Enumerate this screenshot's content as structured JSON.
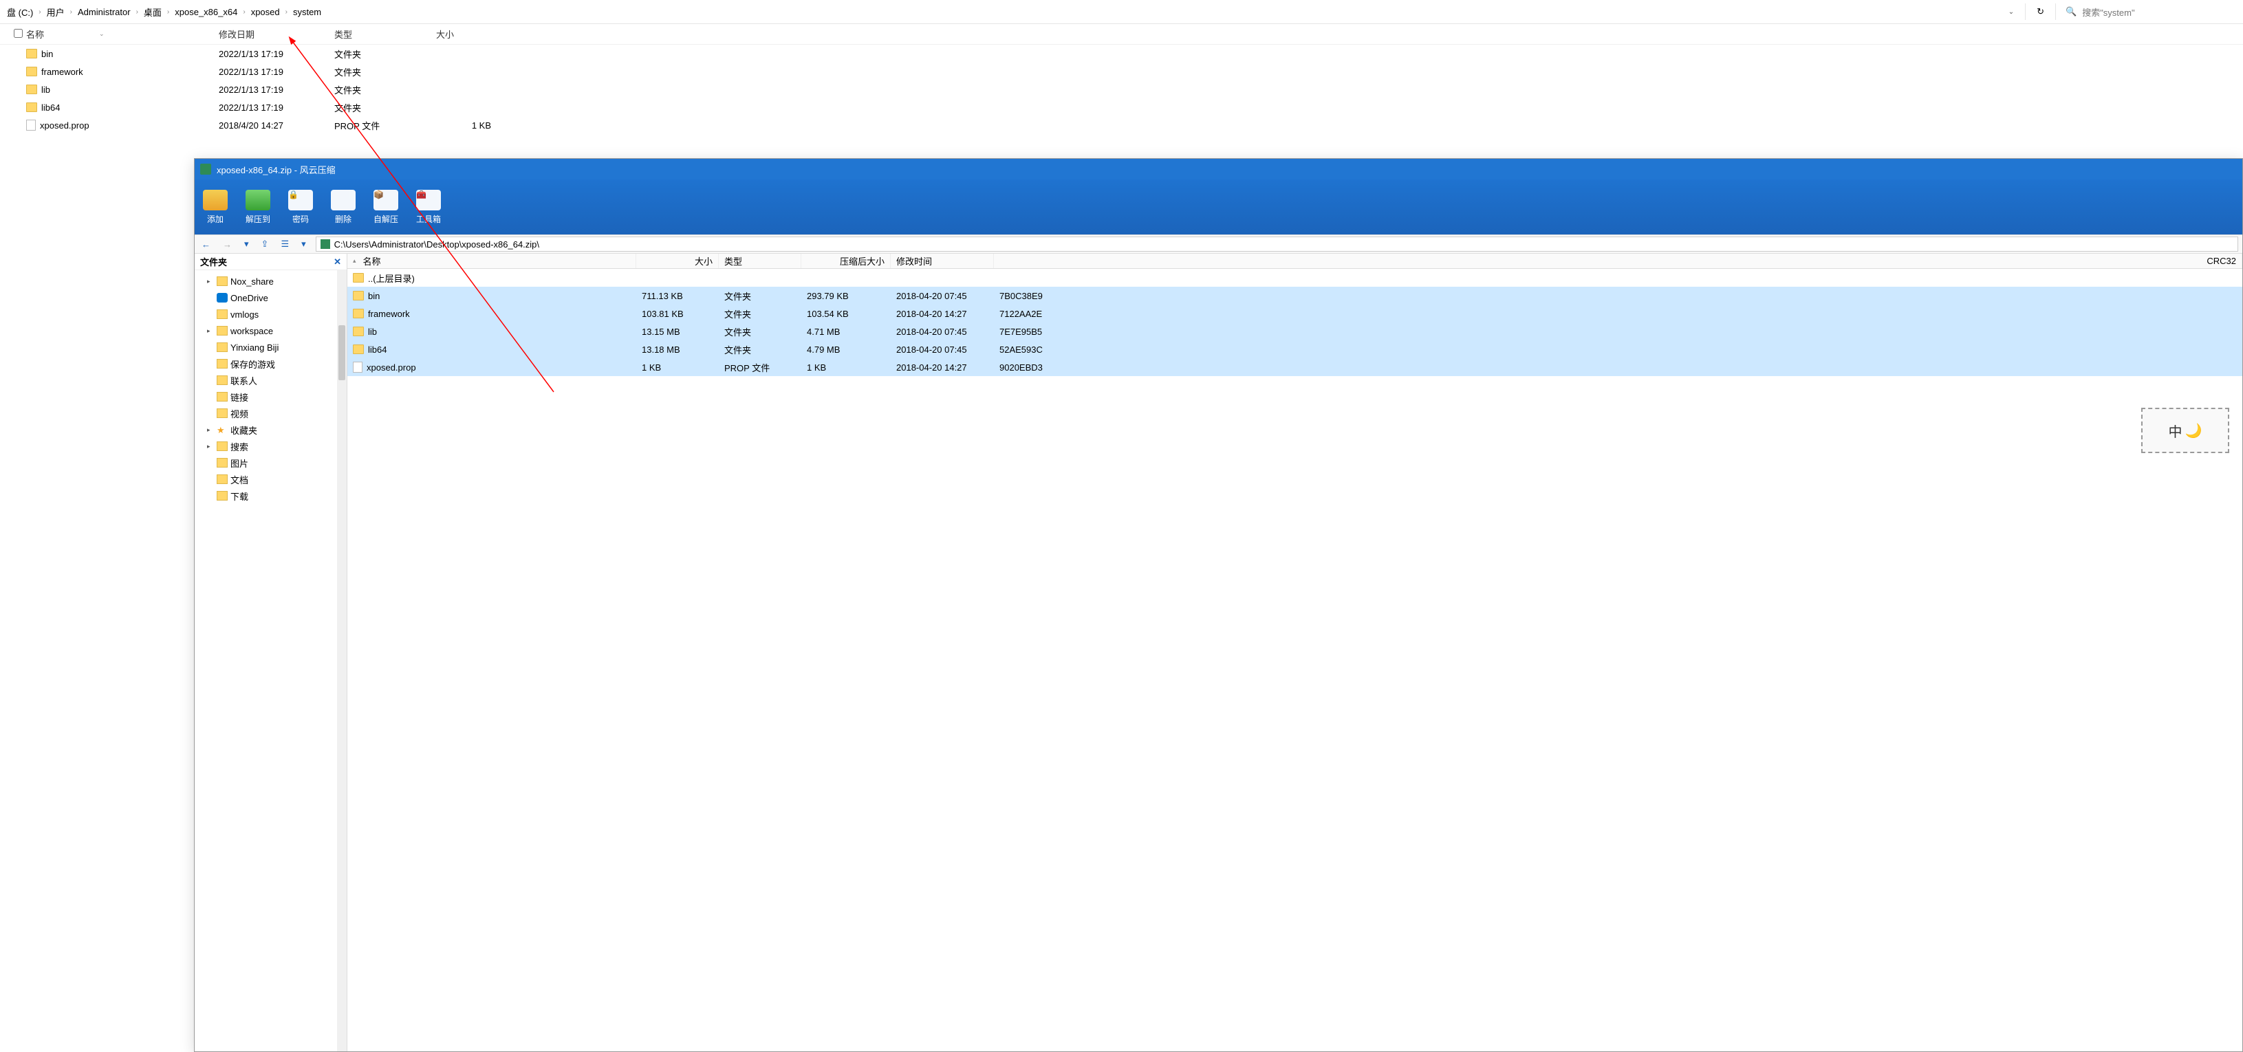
{
  "explorer": {
    "breadcrumb": [
      "盘 (C:)",
      "用户",
      "Administrator",
      "桌面",
      "xpose_x86_x64",
      "xposed",
      "system"
    ],
    "search_placeholder": "搜索\"system\"",
    "columns": {
      "name": "名称",
      "date": "修改日期",
      "type": "类型",
      "size": "大小"
    },
    "rows": [
      {
        "icon": "folder",
        "name": "bin",
        "date": "2022/1/13 17:19",
        "type": "文件夹",
        "size": ""
      },
      {
        "icon": "folder",
        "name": "framework",
        "date": "2022/1/13 17:19",
        "type": "文件夹",
        "size": ""
      },
      {
        "icon": "folder",
        "name": "lib",
        "date": "2022/1/13 17:19",
        "type": "文件夹",
        "size": ""
      },
      {
        "icon": "folder",
        "name": "lib64",
        "date": "2022/1/13 17:19",
        "type": "文件夹",
        "size": ""
      },
      {
        "icon": "file",
        "name": "xposed.prop",
        "date": "2018/4/20 14:27",
        "type": "PROP 文件",
        "size": "1 KB"
      }
    ]
  },
  "archive": {
    "title": "xposed-x86_64.zip - 风云压缩",
    "toolbar": {
      "add": "添加",
      "extract": "解压到",
      "password": "密码",
      "delete": "删除",
      "sfx": "自解压",
      "tools": "工具箱"
    },
    "path": "C:\\Users\\Administrator\\Desktop\\xposed-x86_64.zip\\",
    "side_title": "文件夹",
    "tree": [
      {
        "exp": true,
        "icon": "folder",
        "label": "Nox_share"
      },
      {
        "exp": false,
        "icon": "onedrive",
        "label": "OneDrive"
      },
      {
        "exp": false,
        "icon": "folder",
        "label": "vmlogs"
      },
      {
        "exp": true,
        "icon": "folder",
        "label": "workspace"
      },
      {
        "exp": false,
        "icon": "folder",
        "label": "Yinxiang Biji"
      },
      {
        "exp": false,
        "icon": "game",
        "label": "保存的游戏"
      },
      {
        "exp": false,
        "icon": "contacts",
        "label": "联系人"
      },
      {
        "exp": false,
        "icon": "link",
        "label": "链接"
      },
      {
        "exp": false,
        "icon": "video",
        "label": "视频"
      },
      {
        "exp": true,
        "icon": "star",
        "label": "收藏夹"
      },
      {
        "exp": true,
        "icon": "search",
        "label": "搜索"
      },
      {
        "exp": false,
        "icon": "pictures",
        "label": "图片"
      },
      {
        "exp": false,
        "icon": "docs",
        "label": "文档"
      },
      {
        "exp": false,
        "icon": "download",
        "label": "下载"
      }
    ],
    "grid_columns": {
      "name": "名称",
      "size": "大小",
      "type": "类型",
      "csize": "压缩后大小",
      "mtime": "修改时间",
      "crc": "CRC32"
    },
    "parent_label": "..(上层目录)",
    "rows": [
      {
        "sel": true,
        "icon": "folder",
        "name": "bin",
        "size": "711.13 KB",
        "type": "文件夹",
        "csize": "293.79 KB",
        "mtime": "2018-04-20 07:45",
        "crc": "7B0C38E9"
      },
      {
        "sel": true,
        "icon": "folder",
        "name": "framework",
        "size": "103.81 KB",
        "type": "文件夹",
        "csize": "103.54 KB",
        "mtime": "2018-04-20 14:27",
        "crc": "7122AA2E"
      },
      {
        "sel": true,
        "icon": "folder",
        "name": "lib",
        "size": "13.15 MB",
        "type": "文件夹",
        "csize": "4.71 MB",
        "mtime": "2018-04-20 07:45",
        "crc": "7E7E95B5"
      },
      {
        "sel": true,
        "icon": "folder",
        "name": "lib64",
        "size": "13.18 MB",
        "type": "文件夹",
        "csize": "4.79 MB",
        "mtime": "2018-04-20 07:45",
        "crc": "52AE593C"
      },
      {
        "sel": true,
        "icon": "file",
        "name": "xposed.prop",
        "size": "1 KB",
        "type": "PROP 文件",
        "csize": "1 KB",
        "mtime": "2018-04-20 14:27",
        "crc": "9020EBD3"
      }
    ]
  },
  "ime": {
    "text": "中"
  }
}
